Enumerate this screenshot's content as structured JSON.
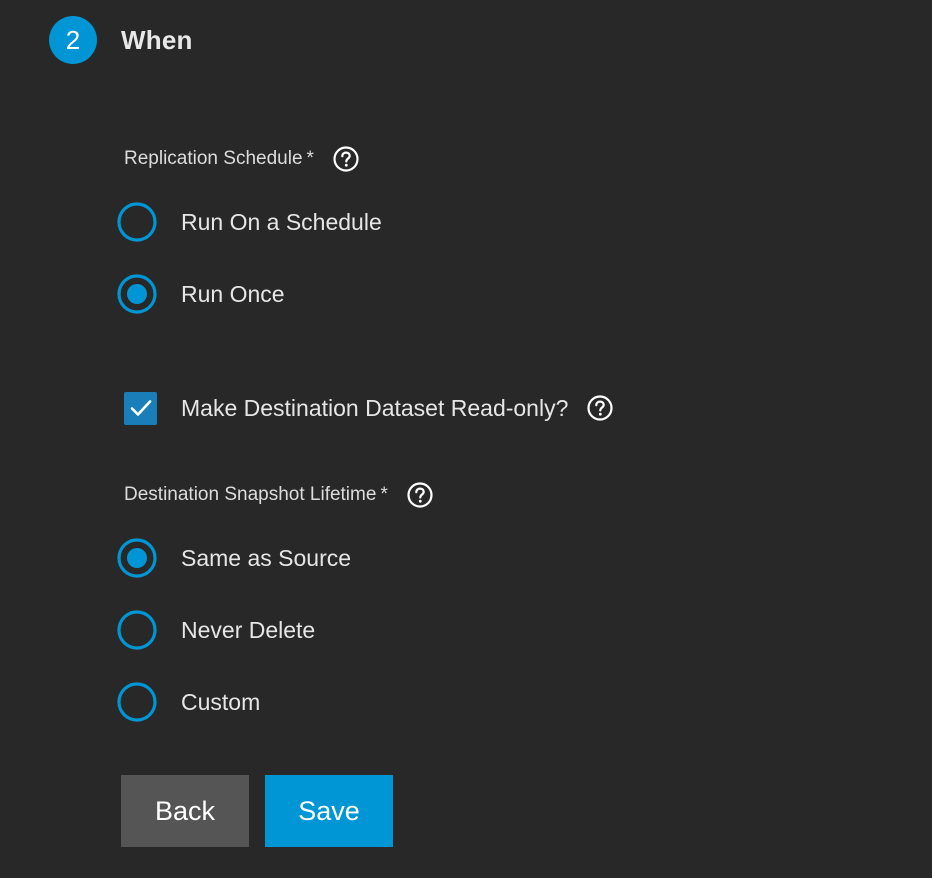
{
  "step": {
    "number": "2",
    "title": "When"
  },
  "replication_schedule": {
    "label": "Replication Schedule",
    "required_mark": "*",
    "help_icon": "help-circle-icon",
    "options": [
      {
        "label": "Run On a Schedule",
        "selected": false
      },
      {
        "label": "Run Once",
        "selected": true
      }
    ]
  },
  "read_only": {
    "label": "Make Destination Dataset Read-only?",
    "checked": true,
    "help_icon": "help-circle-icon"
  },
  "snapshot_lifetime": {
    "label": "Destination Snapshot Lifetime",
    "required_mark": "*",
    "help_icon": "help-circle-icon",
    "options": [
      {
        "label": "Same as Source",
        "selected": true
      },
      {
        "label": "Never Delete",
        "selected": false
      },
      {
        "label": "Custom",
        "selected": false
      }
    ]
  },
  "buttons": {
    "back": "Back",
    "save": "Save"
  },
  "colors": {
    "accent": "#0095d5",
    "background": "#282828",
    "checkbox": "#1a7fb8",
    "back_button": "#555555"
  }
}
